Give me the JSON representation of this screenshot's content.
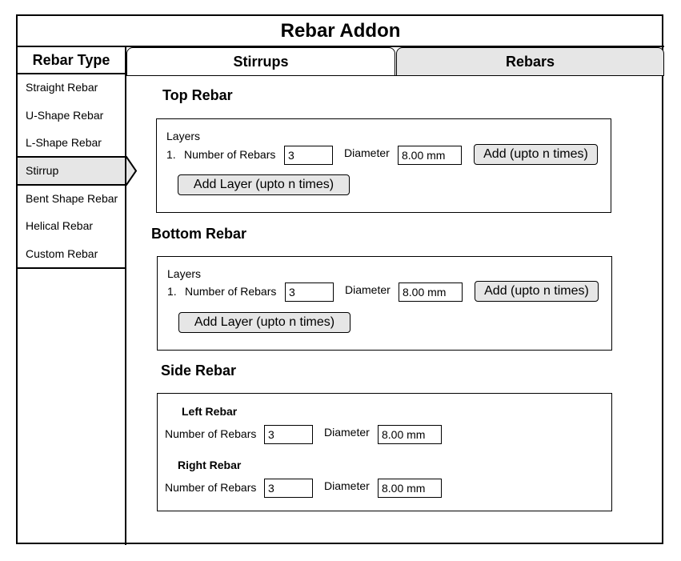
{
  "app": {
    "title": "Rebar Addon"
  },
  "sidebar": {
    "header": "Rebar Type",
    "items": [
      {
        "label": "Straight Rebar"
      },
      {
        "label": "U-Shape Rebar"
      },
      {
        "label": "L-Shape Rebar"
      },
      {
        "label": "Stirrup"
      },
      {
        "label": "Bent Shape Rebar"
      },
      {
        "label": "Helical Rebar"
      },
      {
        "label": "Custom Rebar"
      }
    ],
    "selected": "Stirrup"
  },
  "tabs": [
    {
      "label": "Stirrups",
      "active": true
    },
    {
      "label": "Rebars",
      "active": false
    }
  ],
  "top_rebar": {
    "title": "Top Rebar",
    "layers_label": "Layers",
    "index": "1.",
    "number_label": "Number of Rebars",
    "number_value": "3",
    "diameter_label": "Diameter",
    "diameter_value": "8.00 mm",
    "add_label": "Add (upto n times)",
    "add_layer_label": "Add Layer (upto n times)"
  },
  "bottom_rebar": {
    "title": "Bottom Rebar",
    "layers_label": "Layers",
    "index": "1.",
    "number_label": "Number of Rebars",
    "number_value": "3",
    "diameter_label": "Diameter",
    "diameter_value": "8.00 mm",
    "add_label": "Add (upto n times)",
    "add_layer_label": "Add Layer (upto n times)"
  },
  "side_rebar": {
    "title": "Side Rebar",
    "left": {
      "title": "Left Rebar",
      "number_label": "Number of Rebars",
      "number_value": "3",
      "diameter_label": "Diameter",
      "diameter_value": "8.00 mm"
    },
    "right": {
      "title": "Right Rebar",
      "number_label": "Number of Rebars",
      "number_value": "3",
      "diameter_label": "Diameter",
      "diameter_value": "8.00 mm"
    }
  },
  "colors": {
    "border": "#000000",
    "selected_bg": "#e6e6e6",
    "button_bg": "#e6e6e6"
  }
}
